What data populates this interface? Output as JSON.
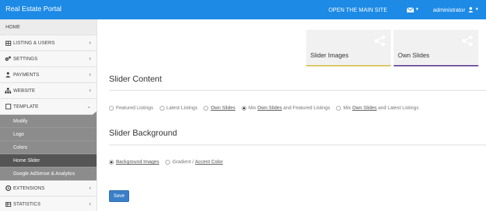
{
  "header": {
    "brand": "Real Estate Portal",
    "open_site": "OPEN THE MAIN SITE",
    "user": "administrator"
  },
  "sidebar": {
    "home": "HOME",
    "items": [
      {
        "label": "LISTING & USERS",
        "icon": "grid-icon"
      },
      {
        "label": "SETTINGS",
        "icon": "cogs-icon"
      },
      {
        "label": "PAYMENTS",
        "icon": "user-icon"
      },
      {
        "label": "WEBSITE",
        "icon": "sitemap-icon"
      },
      {
        "label": "TEMPLATE",
        "icon": "square-icon"
      }
    ],
    "sub_items": [
      "Modify",
      "Logo",
      "Colors",
      "Home Slider",
      "Google AdSense & Analytics"
    ],
    "bottom_items": [
      {
        "label": "EXTENSIONS",
        "icon": "extensions-icon"
      },
      {
        "label": "STATISTICS",
        "icon": "chart-icon"
      }
    ]
  },
  "cards": [
    {
      "label": "Slider Images",
      "color": "#d9c45a"
    },
    {
      "label": "Own Slides",
      "color": "#6b4f9c"
    }
  ],
  "slider_content": {
    "title": "Slider Content",
    "options": [
      {
        "parts": [
          "Featured Listings"
        ]
      },
      {
        "parts": [
          "Latest Listings"
        ]
      },
      {
        "parts": [
          "Own Slides"
        ]
      },
      {
        "parts": [
          "Mix ",
          "Own Slides",
          " and Featured Listings"
        ]
      },
      {
        "parts": [
          "Mix ",
          "Own Slides",
          " and Latest Listings"
        ]
      }
    ]
  },
  "slider_background": {
    "title": "Slider Background",
    "options": [
      {
        "parts": [
          "Background Images"
        ]
      },
      {
        "parts": [
          "Gradient / ",
          "Accent Color"
        ]
      }
    ]
  },
  "save_label": "Save"
}
